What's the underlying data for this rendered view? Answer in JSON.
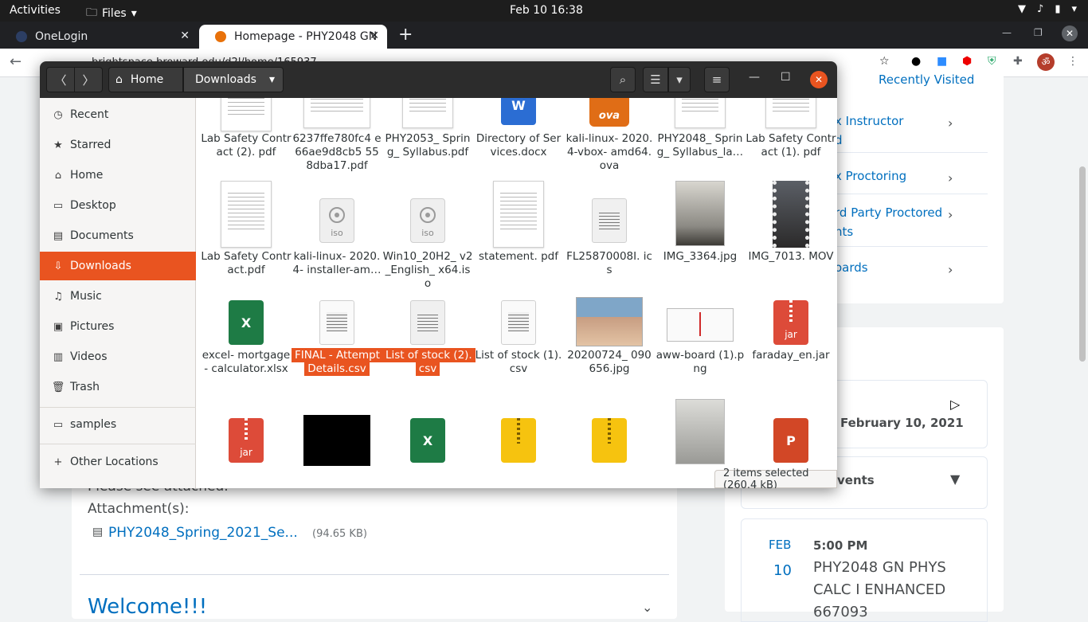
{
  "topbar": {
    "activities": "Activities",
    "files_menu": "Files",
    "clock": "Feb 10  16:38"
  },
  "browser": {
    "tabs": [
      {
        "label": "OneLogin",
        "color": "#2c3e63"
      },
      {
        "label": "Homepage - PHY2048 GN",
        "color": "#e8710a"
      }
    ],
    "url": "brightspace.broward.edu/d2l/home/165937"
  },
  "page": {
    "right_links": [
      "Recently Visited",
      "x Instructor",
      "d",
      "x Proctoring",
      "rd Party Proctored",
      "nts",
      "oards"
    ],
    "date_label": "February 10, 2021",
    "events_label": "vents",
    "event": {
      "month": "FEB",
      "day": "10",
      "time": "5:00 PM",
      "title_line1": "PHY2048 GN PHYS",
      "title_line2": "CALC I ENHANCED",
      "title_line3": "667093"
    },
    "please_see": "Please see attached.",
    "attachments_label": "Attachment(s):",
    "attachment_name": "PHY2048_Spring_2021_Se...",
    "attachment_size": "(94.65 KB)",
    "welcome": "Welcome!!!"
  },
  "files": {
    "header": {
      "home": "Home",
      "current": "Downloads"
    },
    "sidebar": [
      {
        "label": "Recent",
        "icon": "clock-icon"
      },
      {
        "label": "Starred",
        "icon": "star-icon"
      },
      {
        "label": "Home",
        "icon": "home-icon"
      },
      {
        "label": "Desktop",
        "icon": "desktop-icon"
      },
      {
        "label": "Documents",
        "icon": "documents-icon"
      },
      {
        "label": "Downloads",
        "icon": "download-icon"
      },
      {
        "label": "Music",
        "icon": "music-icon"
      },
      {
        "label": "Pictures",
        "icon": "pictures-icon"
      },
      {
        "label": "Videos",
        "icon": "videos-icon"
      },
      {
        "label": "Trash",
        "icon": "trash-icon"
      },
      {
        "label": "samples",
        "icon": "folder-icon"
      },
      {
        "label": "Other Locations",
        "icon": "plus-icon"
      }
    ],
    "items_row1": [
      "Lab Safety Contract (2). pdf",
      "6237ffe780fc4 e66ae9d8cb5 558dba17.pdf",
      "PHY2053_ Spring_ Syllabus.pdf",
      "Directory of Services.docx",
      "kali-linux- 2020.4-vbox- amd64.ova",
      "PHY2048_ Spring_ Syllabus_la…",
      "Lab Safety Contract (1). pdf"
    ],
    "items_row2": [
      "Lab Safety Contract.pdf",
      "kali-linux- 2020.4- installer-am…",
      "Win10_20H2_ v2_English_ x64.iso",
      "statement. pdf",
      "FL25870008I. ics",
      "IMG_3364.jpg",
      "IMG_7013. MOV"
    ],
    "items_row3": [
      "excel- mortgage- calculator.xlsx",
      "FINAL - Attempt Details.csv",
      "List of stock (2).csv",
      "List of stock (1).csv",
      "20200724_ 090656.jpg",
      "aww-board (1).png",
      "faraday_en.jar"
    ],
    "iso_label": "iso",
    "jar_label": "jar",
    "ova_label": "ova",
    "status": "2 items selected  (260.4 kB)"
  }
}
